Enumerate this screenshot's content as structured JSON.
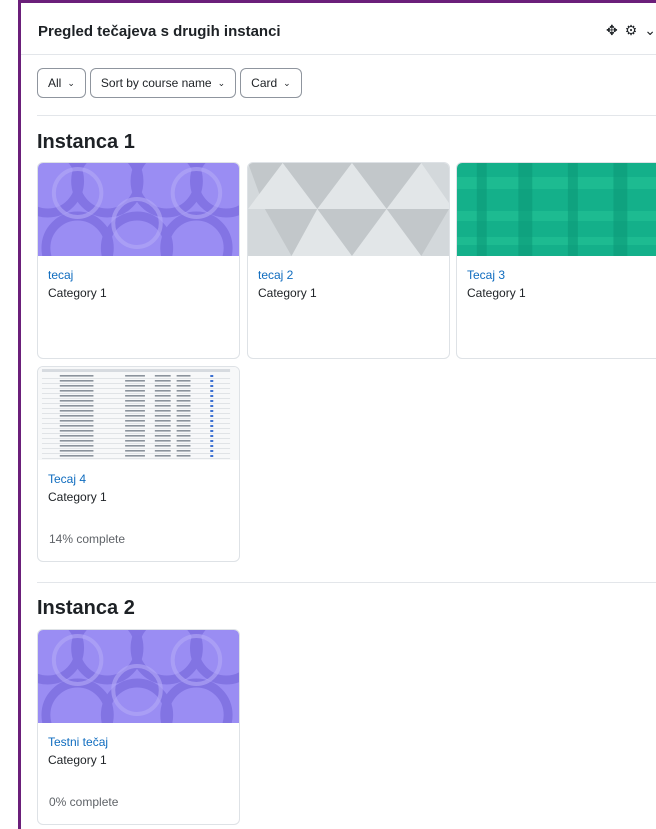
{
  "block": {
    "title": "Pregled tečajeva s drugih instanci",
    "move_glyph": "✥",
    "gear_glyph": "⚙",
    "menu_glyph": "⌄"
  },
  "filters": {
    "grouping": "All",
    "sort": "Sort by course name",
    "view": "Card"
  },
  "sections": [
    {
      "title": "Instanca 1",
      "courses": [
        {
          "name": "tecaj",
          "category": "Category 1",
          "image": "purple-circles"
        },
        {
          "name": "tecaj 2",
          "category": "Category 1",
          "image": "grey-triangles"
        },
        {
          "name": "Tecaj 3",
          "category": "Category 1",
          "image": "green-plaid"
        },
        {
          "name": "Tecaj 4",
          "category": "Category 1",
          "image": "table-screenshot",
          "progress": "14% complete"
        }
      ]
    },
    {
      "title": "Instanca 2",
      "courses": [
        {
          "name": "Testni tečaj",
          "category": "Category 1",
          "image": "purple-circles",
          "progress": "0% complete"
        }
      ]
    }
  ],
  "colors": {
    "frame": "#6b1f7a",
    "link": "#0f6cbf",
    "purple_bg": "#9a8df3",
    "grey_bg": "#d3d8db",
    "green_bg": "#14b08a"
  }
}
